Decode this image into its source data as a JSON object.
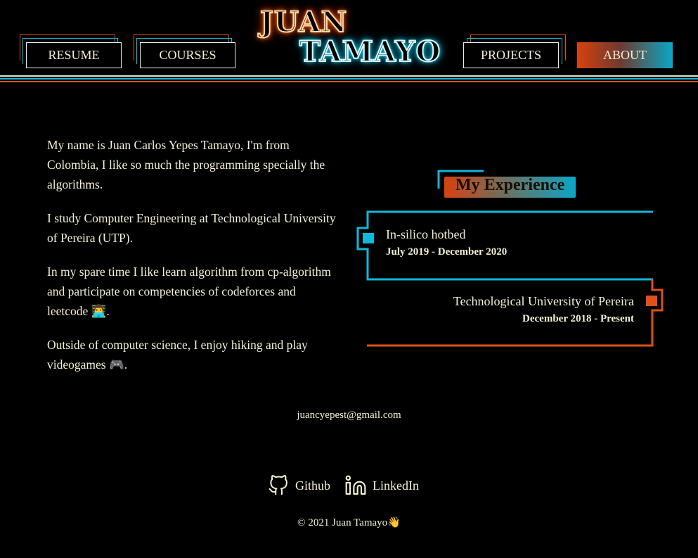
{
  "nav": {
    "resume": "RESUME",
    "courses": "COURSES",
    "projects": "PROJECTS",
    "about": "ABOUT"
  },
  "logo": {
    "line1": "JUAN",
    "line2": "TAMAYO"
  },
  "about": {
    "paragraphs": [
      "My name is Juan Carlos Yepes Tamayo, I'm from Colombia, I like so much the programming specially the algorithms.",
      "I study Computer Engineering at Technological University of Pereira (UTP).",
      "In my spare time I like learn algorithm from cp-algorithm and participate on competencies of codeforces and leetcode 👨‍💻.",
      "Outside of computer science, I enjoy hiking and play videogames 🎮."
    ]
  },
  "experience": {
    "title": "My Experience",
    "items": [
      {
        "title": "In-silico hotbed",
        "dates": "July 2019 - December 2020"
      },
      {
        "title": "Technological University of Pereira",
        "dates": "December 2018 - Present"
      }
    ]
  },
  "footer": {
    "email": "juancyepest@gmail.com",
    "github": "Github",
    "linkedin": "LinkedIn",
    "copyright": "© 2021 Juan Tamayo👋"
  },
  "colors": {
    "background": "#000000",
    "text": "#f5f0d4",
    "accent_orange": "#e0501a",
    "accent_cyan": "#10b8d8"
  },
  "icons": [
    "github-icon",
    "linkedin-icon"
  ]
}
